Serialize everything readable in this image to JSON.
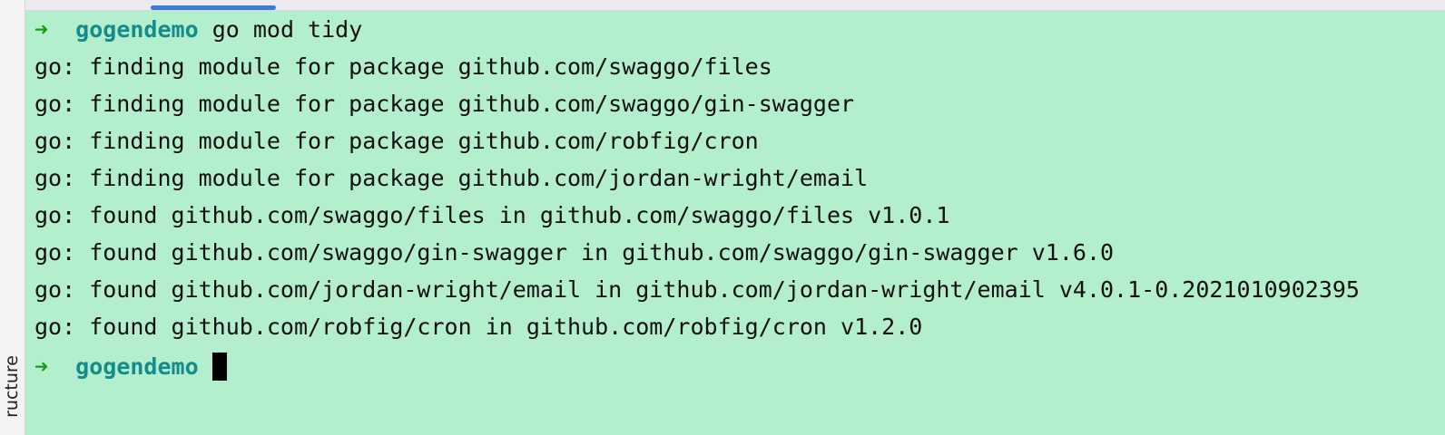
{
  "sidebar": {
    "tab_label": "ructure"
  },
  "terminal": {
    "prompt": {
      "arrow": "➜",
      "directory": "gogendemo"
    },
    "command": "go mod tidy",
    "output_lines": [
      "go: finding module for package github.com/swaggo/files",
      "go: finding module for package github.com/swaggo/gin-swagger",
      "go: finding module for package github.com/robfig/cron",
      "go: finding module for package github.com/jordan-wright/email",
      "go: found github.com/swaggo/files in github.com/swaggo/files v1.0.1",
      "go: found github.com/swaggo/gin-swagger in github.com/swaggo/gin-swagger v1.6.0",
      "go: found github.com/jordan-wright/email in github.com/jordan-wright/email v4.0.1-0.2021010902395",
      "go: found github.com/robfig/cron in github.com/robfig/cron v1.2.0"
    ]
  },
  "colors": {
    "terminal_background": "#b3eecd",
    "prompt_arrow": "#1a9a1a",
    "prompt_directory": "#148c8c",
    "active_tab_indicator": "#3d7bd9"
  }
}
